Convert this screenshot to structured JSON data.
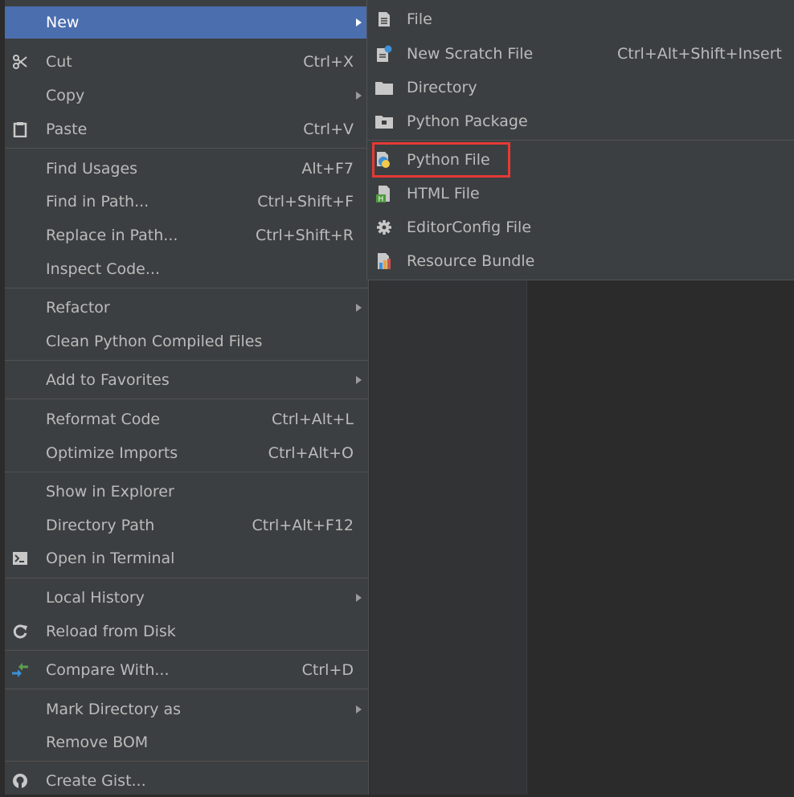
{
  "main_menu": {
    "items": [
      {
        "label": "New",
        "shortcut": "",
        "submenu": true,
        "icon": ""
      },
      {
        "label": "Cut",
        "shortcut": "Ctrl+X",
        "submenu": false,
        "icon": "scissors-icon"
      },
      {
        "label": "Copy",
        "shortcut": "",
        "submenu": true,
        "icon": ""
      },
      {
        "label": "Paste",
        "shortcut": "Ctrl+V",
        "submenu": false,
        "icon": "clipboard-icon"
      },
      {
        "label": "Find Usages",
        "shortcut": "Alt+F7",
        "submenu": false,
        "icon": ""
      },
      {
        "label": "Find in Path...",
        "shortcut": "Ctrl+Shift+F",
        "submenu": false,
        "icon": ""
      },
      {
        "label": "Replace in Path...",
        "shortcut": "Ctrl+Shift+R",
        "submenu": false,
        "icon": ""
      },
      {
        "label": "Inspect Code...",
        "shortcut": "",
        "submenu": false,
        "icon": ""
      },
      {
        "label": "Refactor",
        "shortcut": "",
        "submenu": true,
        "icon": ""
      },
      {
        "label": "Clean Python Compiled Files",
        "shortcut": "",
        "submenu": false,
        "icon": ""
      },
      {
        "label": "Add to Favorites",
        "shortcut": "",
        "submenu": true,
        "icon": ""
      },
      {
        "label": "Reformat Code",
        "shortcut": "Ctrl+Alt+L",
        "submenu": false,
        "icon": ""
      },
      {
        "label": "Optimize Imports",
        "shortcut": "Ctrl+Alt+O",
        "submenu": false,
        "icon": ""
      },
      {
        "label": "Show in Explorer",
        "shortcut": "",
        "submenu": false,
        "icon": ""
      },
      {
        "label": "Directory Path",
        "shortcut": "Ctrl+Alt+F12",
        "submenu": false,
        "icon": ""
      },
      {
        "label": "Open in Terminal",
        "shortcut": "",
        "submenu": false,
        "icon": "terminal-icon"
      },
      {
        "label": "Local History",
        "shortcut": "",
        "submenu": true,
        "icon": ""
      },
      {
        "label": "Reload from Disk",
        "shortcut": "",
        "submenu": false,
        "icon": "reload-icon"
      },
      {
        "label": "Compare With...",
        "shortcut": "Ctrl+D",
        "submenu": false,
        "icon": "compare-icon"
      },
      {
        "label": "Mark Directory as",
        "shortcut": "",
        "submenu": true,
        "icon": ""
      },
      {
        "label": "Remove BOM",
        "shortcut": "",
        "submenu": false,
        "icon": ""
      },
      {
        "label": "Create Gist...",
        "shortcut": "",
        "submenu": false,
        "icon": "github-icon"
      }
    ],
    "selected": "New"
  },
  "new_submenu": {
    "items": [
      {
        "label": "File",
        "shortcut": "",
        "icon": "file-icon"
      },
      {
        "label": "New Scratch File",
        "shortcut": "Ctrl+Alt+Shift+Insert",
        "icon": "scratch-file-icon"
      },
      {
        "label": "Directory",
        "shortcut": "",
        "icon": "folder-icon"
      },
      {
        "label": "Python Package",
        "shortcut": "",
        "icon": "package-folder-icon"
      },
      {
        "label": "Python File",
        "shortcut": "",
        "icon": "python-file-icon"
      },
      {
        "label": "HTML File",
        "shortcut": "",
        "icon": "html-file-icon"
      },
      {
        "label": "EditorConfig File",
        "shortcut": "",
        "icon": "gear-icon"
      },
      {
        "label": "Resource Bundle",
        "shortcut": "",
        "icon": "resource-bundle-icon"
      }
    ],
    "highlighted": "Python File"
  },
  "colors": {
    "menu_bg": "#3c3f41",
    "selection": "#4b6eaf",
    "highlight_box": "#e53935",
    "text": "#bbbbbb"
  }
}
